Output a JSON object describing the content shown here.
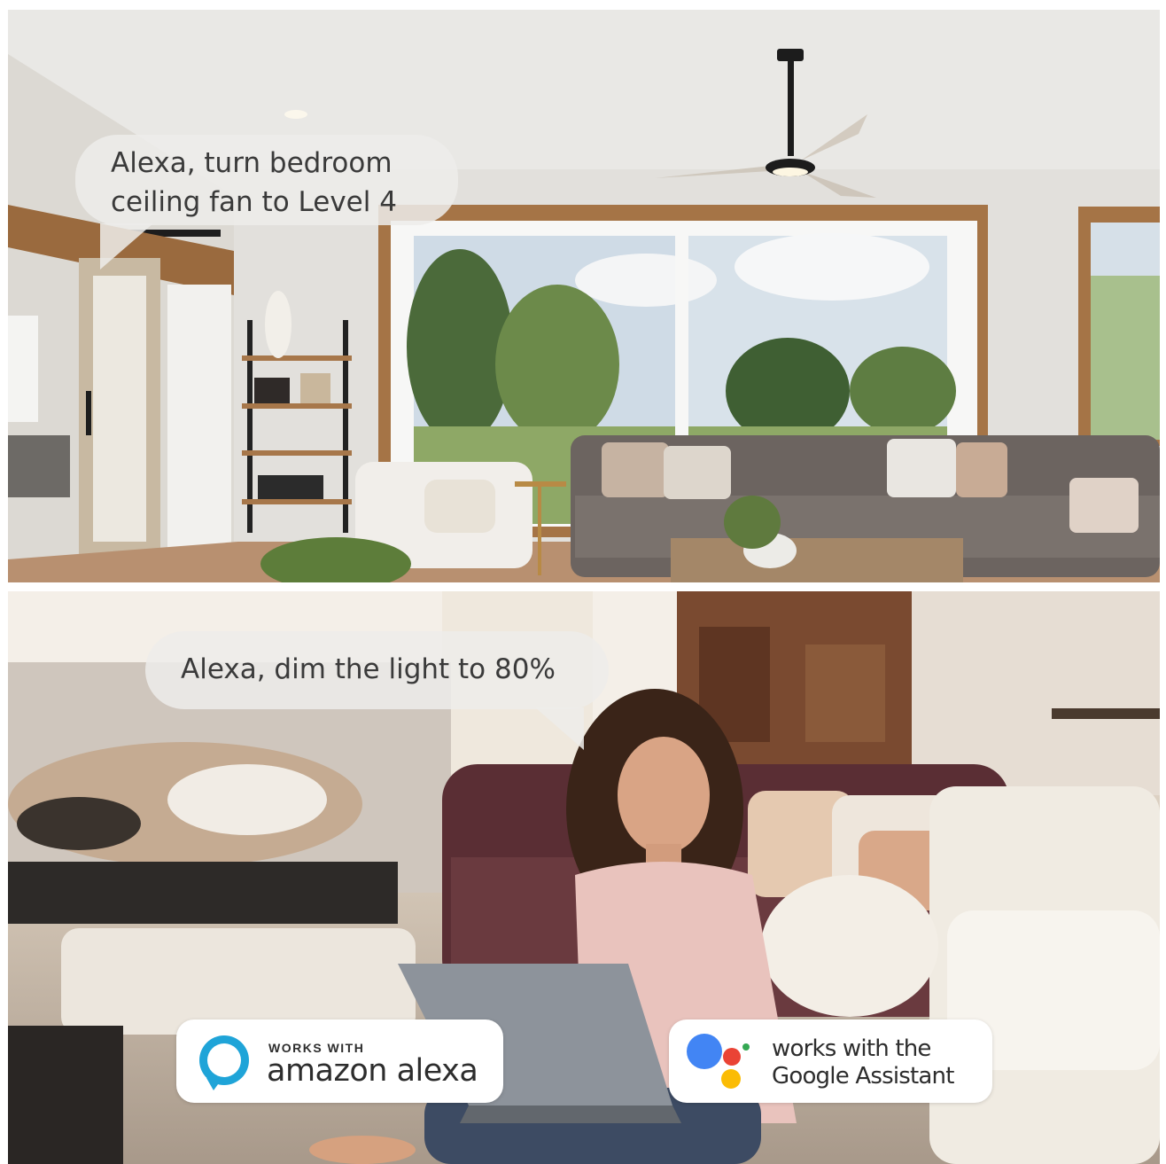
{
  "scene_top": {
    "speech_line1": "Alexa, turn bedroom",
    "speech_line2": "ceiling fan to Level 4"
  },
  "scene_bottom": {
    "speech_text": "Alexa, dim the light to 80%"
  },
  "badges": {
    "alexa": {
      "small_label": "WORKS WITH",
      "big_label": "amazon alexa",
      "icon": "alexa-ring-icon"
    },
    "google": {
      "line1": "works with the",
      "line2": "Google Assistant",
      "icon": "google-assistant-icon"
    }
  },
  "colors": {
    "bubble_bg": "#eeecea",
    "alexa_blue": "#1fa4d8",
    "google_blue": "#4285f4",
    "google_red": "#ea4335",
    "google_yellow": "#fbbc05",
    "google_green": "#34a853"
  }
}
